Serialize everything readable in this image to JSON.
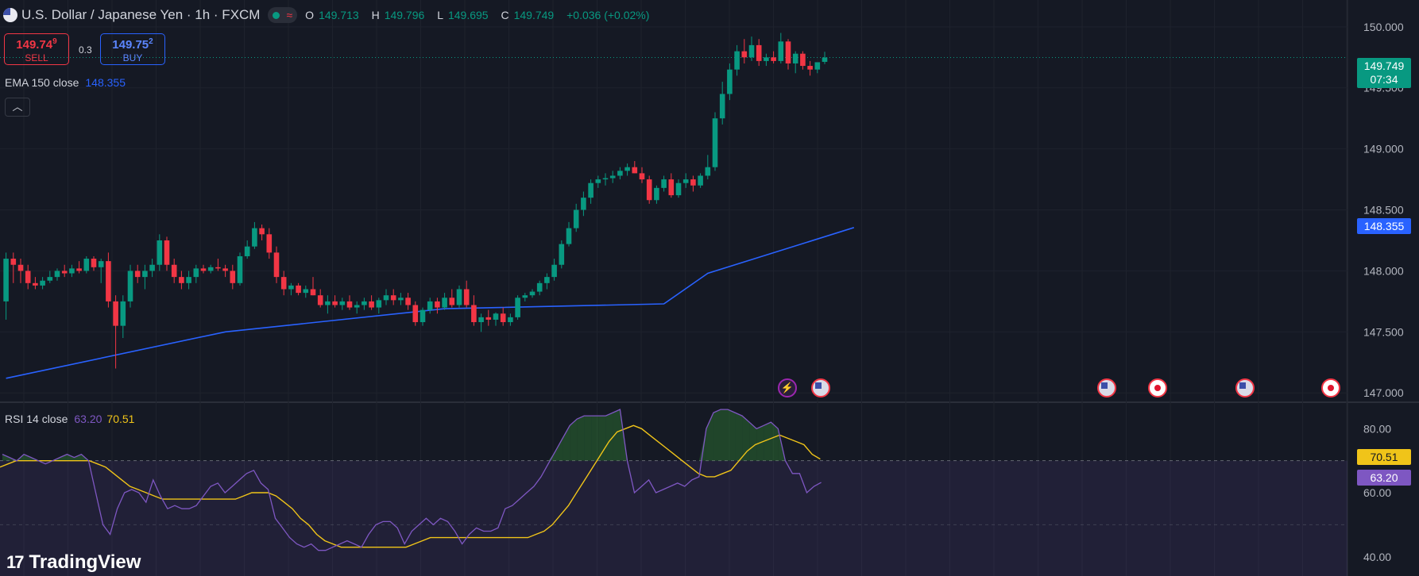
{
  "header": {
    "symbol_title": "U.S. Dollar / Japanese Yen · 1h · FXCM",
    "open_label": "O",
    "open": "149.713",
    "high_label": "H",
    "high": "149.796",
    "low_label": "L",
    "low": "149.695",
    "close_label": "C",
    "close": "149.749",
    "change": "+0.036 (+0.02%)"
  },
  "trade": {
    "sell_price": "149.74",
    "sell_price_pip": "9",
    "sell_label": "SELL",
    "spread": "0.3",
    "buy_price": "149.75",
    "buy_price_pip": "2",
    "buy_label": "BUY"
  },
  "ema_legend": {
    "label": "EMA 150 close",
    "value": "148.355"
  },
  "rsi_legend": {
    "label": "RSI 14 close",
    "value": "63.20",
    "ma_value": "70.51"
  },
  "badges": {
    "last_price": "149.749",
    "countdown": "07:34",
    "ema": "148.355",
    "rsi_ma": "70.51",
    "rsi": "63.20"
  },
  "logo": {
    "mark": "17",
    "text": "TradingView"
  },
  "colors": {
    "up": "#089981",
    "down": "#f23645",
    "ema": "#2962ff",
    "rsi": "#7e57c2",
    "rsi_ma": "#f0c419",
    "background": "#151924"
  },
  "events": [
    {
      "icon": "lightning-event-icon"
    },
    {
      "icon": "us-flag-icon"
    },
    {
      "icon": "us-flag-icon"
    },
    {
      "icon": "japan-flag-icon"
    },
    {
      "icon": "us-flag-icon"
    },
    {
      "icon": "japan-flag-icon"
    }
  ],
  "chart_data": [
    {
      "type": "candlestick",
      "title": "U.S. Dollar / Japanese Yen · 1h · FXCM",
      "ylim": [
        146.93,
        150.22
      ],
      "yticks": [
        "150.000",
        "149.500",
        "149.000",
        "148.500",
        "148.000",
        "147.500",
        "147.000"
      ],
      "ohlc": [
        [
          147.75,
          148.15,
          147.6,
          148.1
        ],
        [
          148.1,
          148.15,
          147.9,
          148.05
        ],
        [
          148.05,
          148.1,
          147.9,
          148.0
        ],
        [
          148.0,
          148.05,
          147.85,
          147.9
        ],
        [
          147.9,
          147.95,
          147.85,
          147.88
        ],
        [
          147.88,
          147.95,
          147.85,
          147.92
        ],
        [
          147.92,
          148.0,
          147.9,
          147.95
        ],
        [
          147.95,
          148.02,
          147.92,
          148.0
        ],
        [
          148.0,
          148.05,
          147.95,
          147.98
        ],
        [
          147.98,
          148.05,
          147.95,
          148.02
        ],
        [
          148.02,
          148.08,
          147.98,
          148.0
        ],
        [
          148.0,
          148.12,
          147.98,
          148.1
        ],
        [
          148.1,
          148.12,
          148.0,
          148.03
        ],
        [
          148.03,
          148.1,
          147.9,
          148.08
        ],
        [
          148.08,
          148.15,
          147.7,
          147.75
        ],
        [
          147.75,
          147.8,
          147.2,
          147.55
        ],
        [
          147.55,
          147.8,
          147.45,
          147.75
        ],
        [
          147.75,
          148.05,
          147.7,
          148.0
        ],
        [
          148.0,
          148.05,
          147.9,
          147.95
        ],
        [
          147.95,
          148.05,
          147.85,
          148.0
        ],
        [
          148.0,
          148.1,
          147.95,
          148.05
        ],
        [
          148.05,
          148.3,
          148.0,
          148.25
        ],
        [
          148.25,
          148.28,
          148.0,
          148.05
        ],
        [
          148.05,
          148.1,
          147.9,
          147.95
        ],
        [
          147.95,
          148.0,
          147.85,
          147.9
        ],
        [
          147.9,
          148.0,
          147.85,
          147.95
        ],
        [
          147.95,
          148.05,
          147.9,
          148.02
        ],
        [
          148.02,
          148.05,
          147.98,
          148.0
        ],
        [
          148.0,
          148.05,
          147.98,
          148.03
        ],
        [
          148.03,
          148.1,
          148.0,
          148.02
        ],
        [
          148.02,
          148.05,
          147.95,
          148.0
        ],
        [
          148.0,
          148.05,
          147.85,
          147.9
        ],
        [
          147.9,
          148.15,
          147.88,
          148.12
        ],
        [
          148.12,
          148.25,
          148.1,
          148.2
        ],
        [
          148.2,
          148.4,
          148.18,
          148.35
        ],
        [
          148.35,
          148.38,
          148.25,
          148.3
        ],
        [
          148.3,
          148.35,
          148.1,
          148.15
        ],
        [
          148.15,
          148.2,
          147.9,
          147.95
        ],
        [
          147.95,
          148.0,
          147.8,
          147.85
        ],
        [
          147.85,
          147.9,
          147.8,
          147.88
        ],
        [
          147.88,
          147.9,
          147.8,
          147.82
        ],
        [
          147.82,
          147.88,
          147.78,
          147.85
        ],
        [
          147.85,
          147.95,
          147.8,
          147.8
        ],
        [
          147.8,
          147.85,
          147.7,
          147.72
        ],
        [
          147.72,
          147.8,
          147.65,
          147.75
        ],
        [
          147.75,
          147.8,
          147.7,
          147.72
        ],
        [
          147.72,
          147.78,
          147.68,
          147.75
        ],
        [
          147.75,
          147.8,
          147.68,
          147.7
        ],
        [
          147.7,
          147.75,
          147.65,
          147.72
        ],
        [
          147.72,
          147.78,
          147.68,
          147.75
        ],
        [
          147.75,
          147.8,
          147.68,
          147.7
        ],
        [
          147.7,
          147.78,
          147.65,
          147.76
        ],
        [
          147.76,
          147.85,
          147.72,
          147.8
        ],
        [
          147.8,
          147.85,
          147.72,
          147.76
        ],
        [
          147.76,
          147.82,
          147.72,
          147.78
        ],
        [
          147.78,
          147.82,
          147.68,
          147.72
        ],
        [
          147.72,
          147.75,
          147.55,
          147.58
        ],
        [
          147.58,
          147.7,
          147.55,
          147.68
        ],
        [
          147.68,
          147.78,
          147.65,
          147.75
        ],
        [
          147.75,
          147.78,
          147.65,
          147.7
        ],
        [
          147.7,
          147.82,
          147.68,
          147.78
        ],
        [
          147.78,
          147.85,
          147.7,
          147.72
        ],
        [
          147.72,
          147.88,
          147.7,
          147.85
        ],
        [
          147.85,
          147.92,
          147.7,
          147.72
        ],
        [
          147.72,
          147.8,
          147.55,
          147.58
        ],
        [
          147.58,
          147.65,
          147.5,
          147.62
        ],
        [
          147.62,
          147.68,
          147.55,
          147.6
        ],
        [
          147.6,
          147.66,
          147.55,
          147.65
        ],
        [
          147.65,
          147.7,
          147.55,
          147.58
        ],
        [
          147.58,
          147.65,
          147.55,
          147.62
        ],
        [
          147.62,
          147.8,
          147.6,
          147.78
        ],
        [
          147.78,
          147.82,
          147.75,
          147.8
        ],
        [
          147.8,
          147.85,
          147.78,
          147.83
        ],
        [
          147.83,
          147.92,
          147.8,
          147.9
        ],
        [
          147.9,
          147.98,
          147.85,
          147.95
        ],
        [
          147.95,
          148.1,
          147.92,
          148.05
        ],
        [
          148.05,
          148.25,
          148.02,
          148.22
        ],
        [
          148.22,
          148.4,
          148.2,
          148.35
        ],
        [
          148.35,
          148.55,
          148.32,
          148.5
        ],
        [
          148.5,
          148.65,
          148.45,
          148.6
        ],
        [
          148.6,
          148.75,
          148.55,
          148.72
        ],
        [
          148.72,
          148.78,
          148.68,
          148.75
        ],
        [
          148.75,
          148.8,
          148.7,
          148.76
        ],
        [
          148.76,
          148.82,
          148.72,
          148.78
        ],
        [
          148.78,
          148.85,
          148.75,
          148.82
        ],
        [
          148.82,
          148.88,
          148.78,
          148.85
        ],
        [
          148.85,
          148.9,
          148.8,
          148.8
        ],
        [
          148.8,
          148.85,
          148.72,
          148.75
        ],
        [
          148.75,
          148.78,
          148.55,
          148.58
        ],
        [
          148.58,
          148.7,
          148.55,
          148.68
        ],
        [
          148.68,
          148.78,
          148.65,
          148.75
        ],
        [
          148.75,
          148.8,
          148.6,
          148.62
        ],
        [
          148.62,
          148.75,
          148.6,
          148.72
        ],
        [
          148.72,
          148.8,
          148.68,
          148.75
        ],
        [
          148.75,
          148.78,
          148.65,
          148.7
        ],
        [
          148.7,
          148.8,
          148.68,
          148.78
        ],
        [
          148.78,
          148.95,
          148.75,
          148.85
        ],
        [
          148.85,
          149.3,
          148.82,
          149.25
        ],
        [
          149.25,
          149.55,
          149.2,
          149.45
        ],
        [
          149.45,
          149.7,
          149.4,
          149.65
        ],
        [
          149.65,
          149.85,
          149.6,
          149.8
        ],
        [
          149.8,
          149.9,
          149.7,
          149.75
        ],
        [
          149.75,
          149.92,
          149.72,
          149.85
        ],
        [
          149.85,
          149.9,
          149.68,
          149.72
        ],
        [
          149.72,
          149.78,
          149.68,
          149.75
        ],
        [
          149.75,
          149.8,
          149.7,
          149.72
        ],
        [
          149.72,
          149.95,
          149.7,
          149.88
        ],
        [
          149.88,
          149.9,
          149.65,
          149.7
        ],
        [
          149.7,
          149.8,
          149.62,
          149.78
        ],
        [
          149.78,
          149.8,
          149.65,
          149.68
        ],
        [
          149.68,
          149.72,
          149.6,
          149.65
        ],
        [
          149.65,
          149.7,
          149.62,
          149.71
        ],
        [
          149.713,
          149.796,
          149.695,
          149.749
        ]
      ],
      "ema": {
        "name": "EMA 150 close",
        "x": [
          0,
          30,
          60,
          90,
          96,
          116
        ],
        "values": [
          147.12,
          147.5,
          147.69,
          147.73,
          147.98,
          148.355
        ]
      }
    },
    {
      "type": "line",
      "title": "RSI 14 close",
      "ylim": [
        34,
        88
      ],
      "yticks": [
        "80.00",
        "60.00",
        "40.00"
      ],
      "bands": [
        70,
        50,
        30
      ],
      "series": [
        {
          "name": "RSI 14 close",
          "values": [
            72,
            71,
            70,
            72,
            71,
            70,
            69,
            70,
            71,
            72,
            71,
            72,
            70,
            60,
            50,
            47,
            55,
            60,
            61,
            60,
            57,
            64,
            59,
            55,
            56,
            55,
            55,
            56,
            59,
            62,
            63,
            60,
            62,
            64,
            66,
            67,
            63,
            61,
            52,
            49,
            46,
            44,
            43,
            44,
            42,
            42,
            43,
            44,
            45,
            44,
            43,
            47,
            50,
            51,
            51,
            49,
            44,
            48,
            50,
            52,
            50,
            52,
            51,
            48,
            44,
            47,
            49,
            48,
            48,
            49,
            55,
            56,
            58,
            60,
            62,
            65,
            69,
            73,
            77,
            81,
            83,
            84,
            84,
            84,
            84,
            85,
            86,
            70,
            60,
            62,
            64,
            60,
            61,
            62,
            63,
            62,
            64,
            65,
            80,
            85,
            86,
            86,
            85,
            84,
            82,
            80,
            81,
            82,
            80,
            70,
            66,
            66,
            60,
            62,
            63.2
          ]
        },
        {
          "name": "RSI MA",
          "values": [
            68,
            69,
            70,
            70,
            70,
            70,
            70,
            70,
            70,
            70,
            70,
            70,
            69,
            68,
            66,
            64,
            62,
            61,
            60,
            59,
            58,
            58,
            58,
            58,
            58,
            58,
            58,
            58,
            58,
            58,
            59,
            60,
            60,
            60,
            59,
            57,
            55,
            52,
            50,
            47,
            45,
            44,
            43,
            43,
            43,
            43,
            43,
            43,
            43,
            43,
            43,
            44,
            45,
            46,
            46,
            46,
            46,
            46,
            46,
            46,
            46,
            46,
            46,
            46,
            46,
            46,
            47,
            48,
            50,
            53,
            56,
            60,
            64,
            68,
            72,
            76,
            79,
            80,
            81,
            80,
            78,
            76,
            74,
            72,
            70,
            68,
            66,
            65,
            65,
            66,
            67,
            70,
            73,
            75,
            76,
            77,
            78,
            77,
            76,
            75,
            72,
            70.51
          ]
        }
      ]
    }
  ]
}
